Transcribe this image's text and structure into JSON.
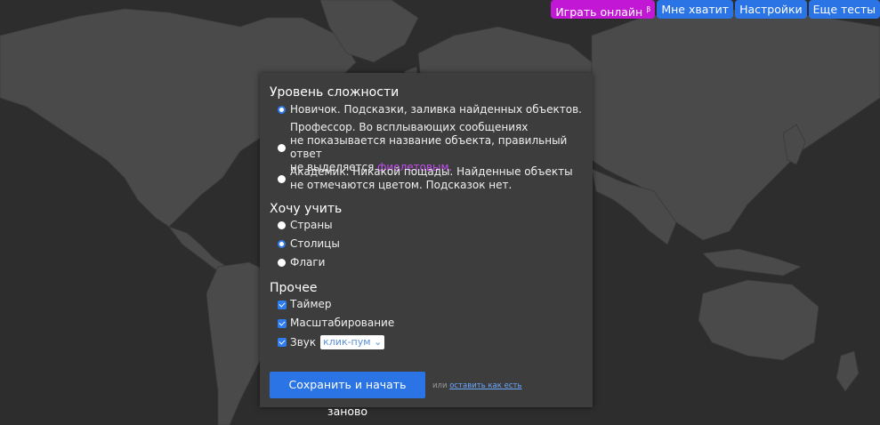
{
  "nav": {
    "play_online": "Играть онлайн",
    "play_sup": "β",
    "enough": "Мне хватит",
    "settings": "Настройки",
    "more_tests": "Еще тесты"
  },
  "difficulty": {
    "title": "Уровень сложности",
    "novice": "Новичок. Подсказки, заливка найденных объектов.",
    "professor_line1": "Профессор. Во всплывающих сообщениях",
    "professor_line2": "не показывается название объекта, правильный ответ",
    "professor_line3_pre": "не выделяется ",
    "professor_line3_color": "фиолетовым.",
    "academic_line1": "Академик. Никакой пощады. Найденные объекты",
    "academic_line2": "не отмечаются цветом. Подсказок нет.",
    "selected": "novice"
  },
  "learn": {
    "title": "Хочу учить",
    "countries": "Страны",
    "capitals": "Столицы",
    "flags": "Флаги",
    "selected": "capitals"
  },
  "other": {
    "title": "Прочее",
    "timer": "Таймер",
    "zoom": "Масштабирование",
    "sound": "Звук",
    "sound_option": "клик-пум"
  },
  "actions": {
    "save": "Сохранить и начать заново",
    "or": "или",
    "keep": "оставить как есть"
  }
}
